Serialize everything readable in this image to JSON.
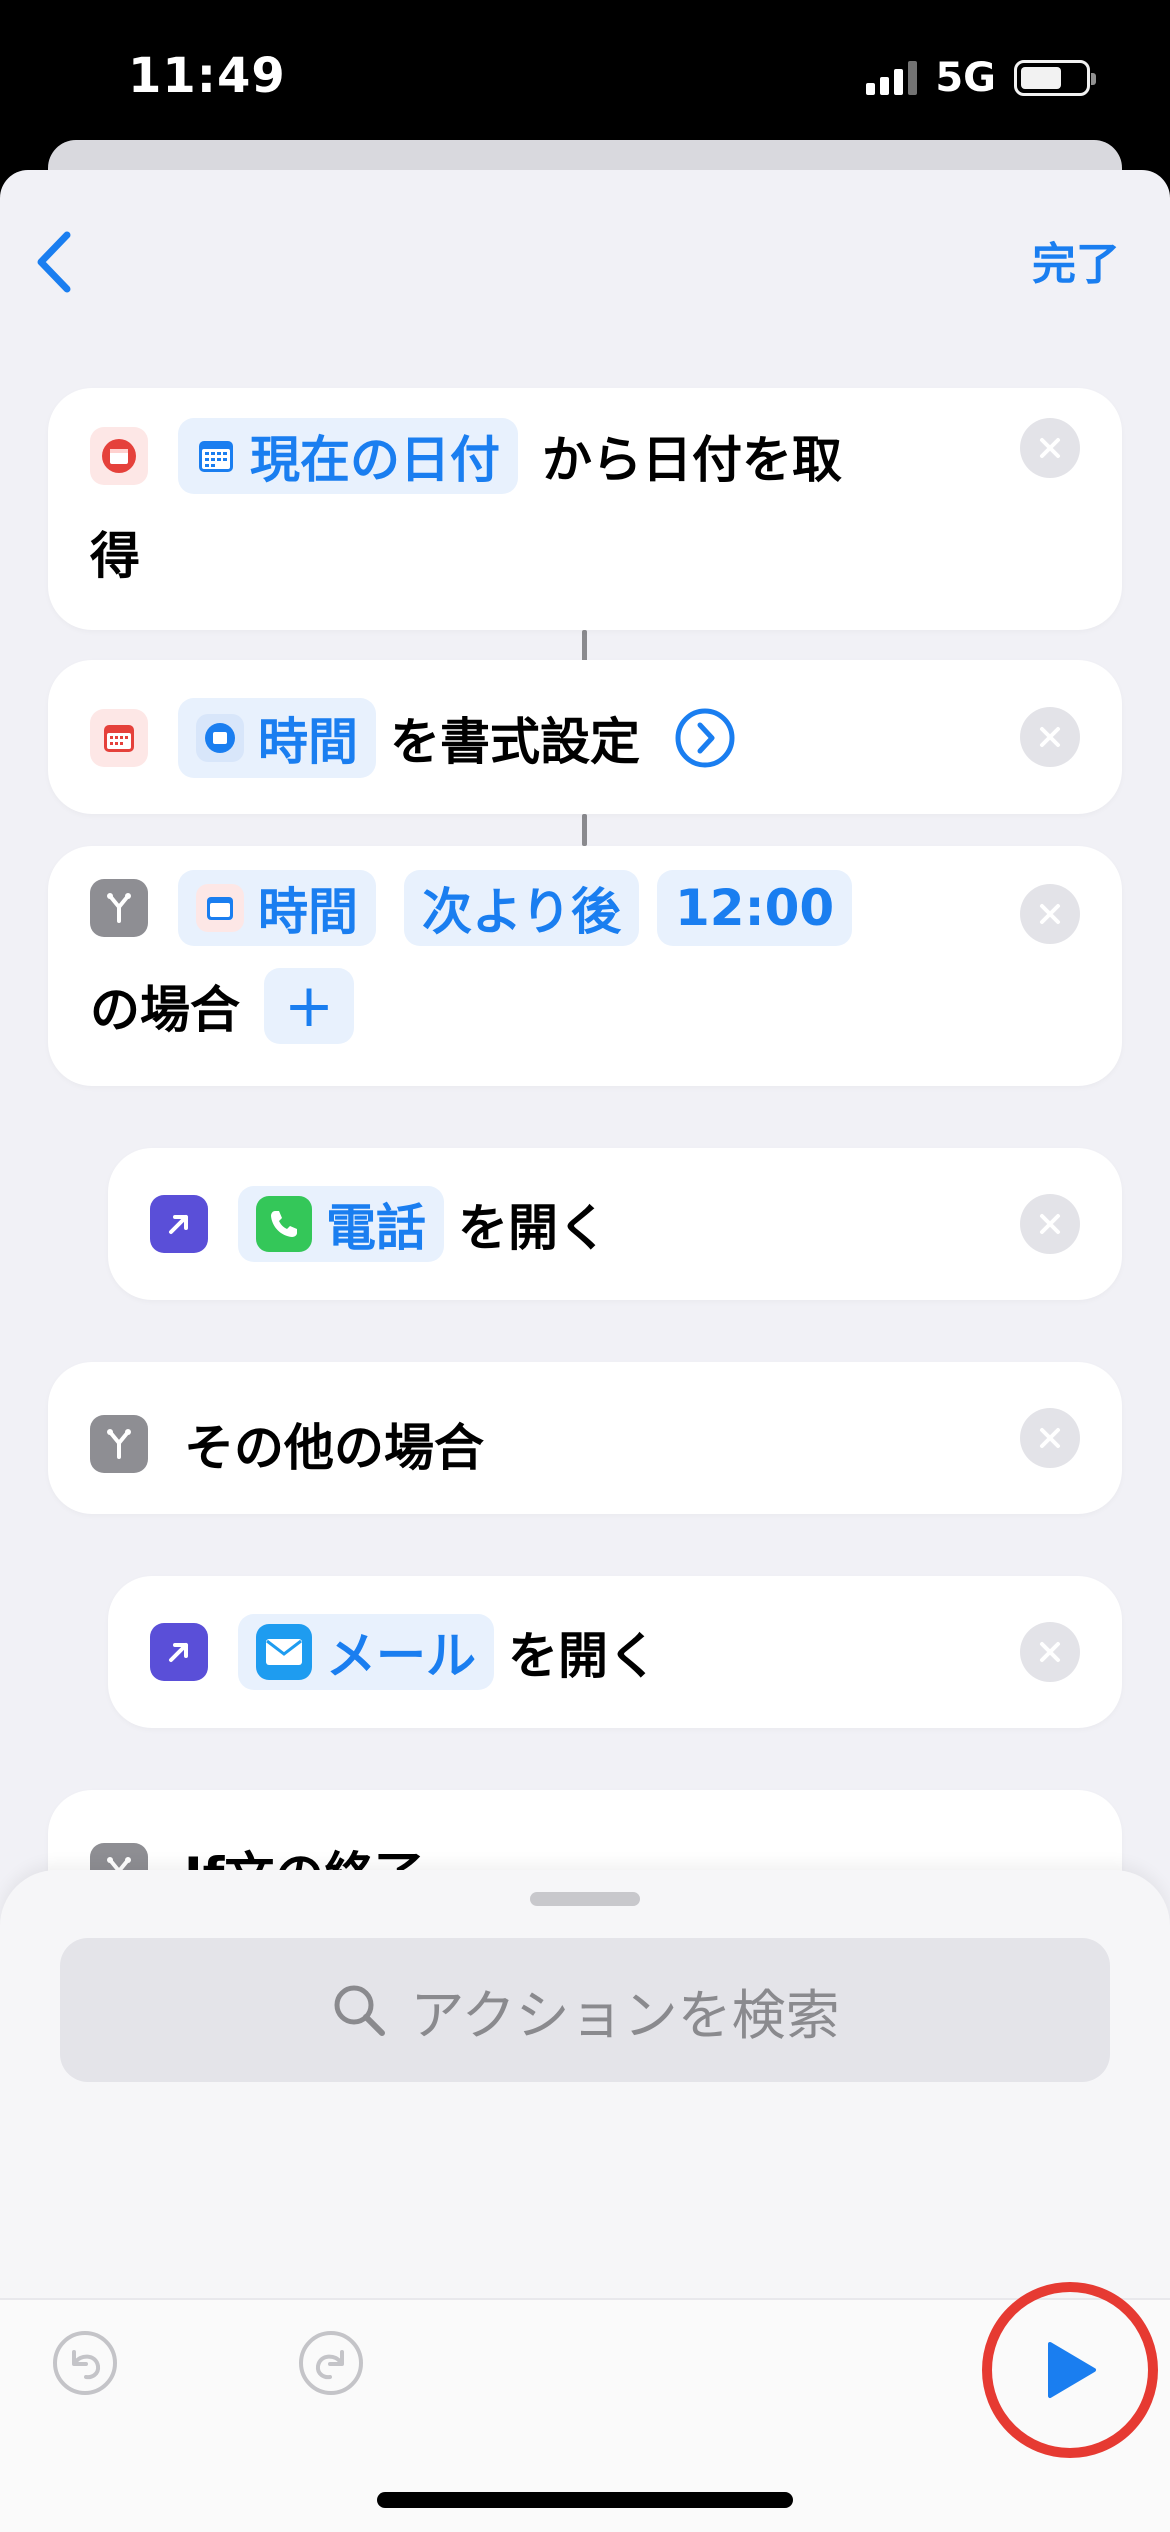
{
  "status_bar": {
    "time": "11:49",
    "network": "5G"
  },
  "nav": {
    "done_label": "完了"
  },
  "actions": [
    {
      "kind": "date",
      "pill": "現在の日付",
      "text_after": "から日付を取",
      "text_line2": "得"
    },
    {
      "kind": "format",
      "pill": "時間",
      "text_after": "を書式設定"
    },
    {
      "kind": "if",
      "pill1": "時間",
      "pill2": "次より後",
      "pill3": "12:00",
      "text_line2": "の場合",
      "add": "+"
    },
    {
      "kind": "open-app",
      "pill": "電話",
      "text_after": "を開く"
    },
    {
      "kind": "otherwise",
      "text": "その他の場合"
    },
    {
      "kind": "open-app",
      "pill": "メール",
      "text_after": "を開く"
    },
    {
      "kind": "end-if",
      "text": "If文の終了"
    }
  ],
  "search": {
    "placeholder": "アクションを検索"
  },
  "colors": {
    "accent": "#1a7ef0",
    "run_ring": "#e63a32",
    "open_app_icon": "#5a4fd8",
    "calendar_red": "#e5413b",
    "branch_gray": "#8e8e93"
  }
}
